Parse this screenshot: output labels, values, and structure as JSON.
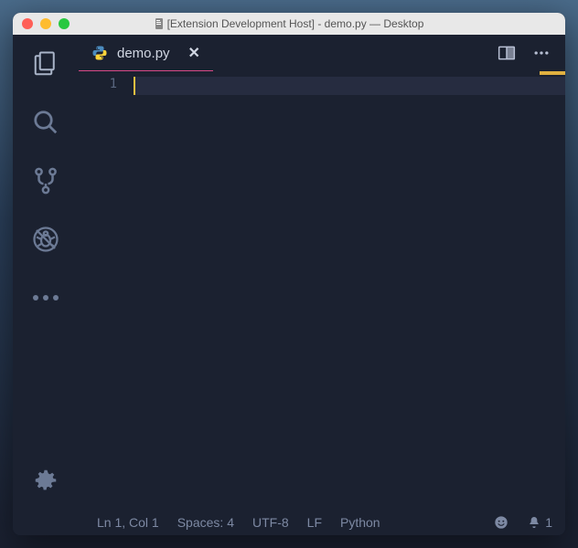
{
  "titlebar": {
    "title": "[Extension Development Host] - demo.py — Desktop"
  },
  "tabs": {
    "items": [
      {
        "label": "demo.py",
        "icon": "python-file-icon"
      }
    ]
  },
  "editor": {
    "line_numbers": [
      "1"
    ]
  },
  "statusbar": {
    "cursor": "Ln 1, Col 1",
    "indent": "Spaces: 4",
    "encoding": "UTF-8",
    "eol": "LF",
    "language": "Python",
    "notifications": "1"
  }
}
